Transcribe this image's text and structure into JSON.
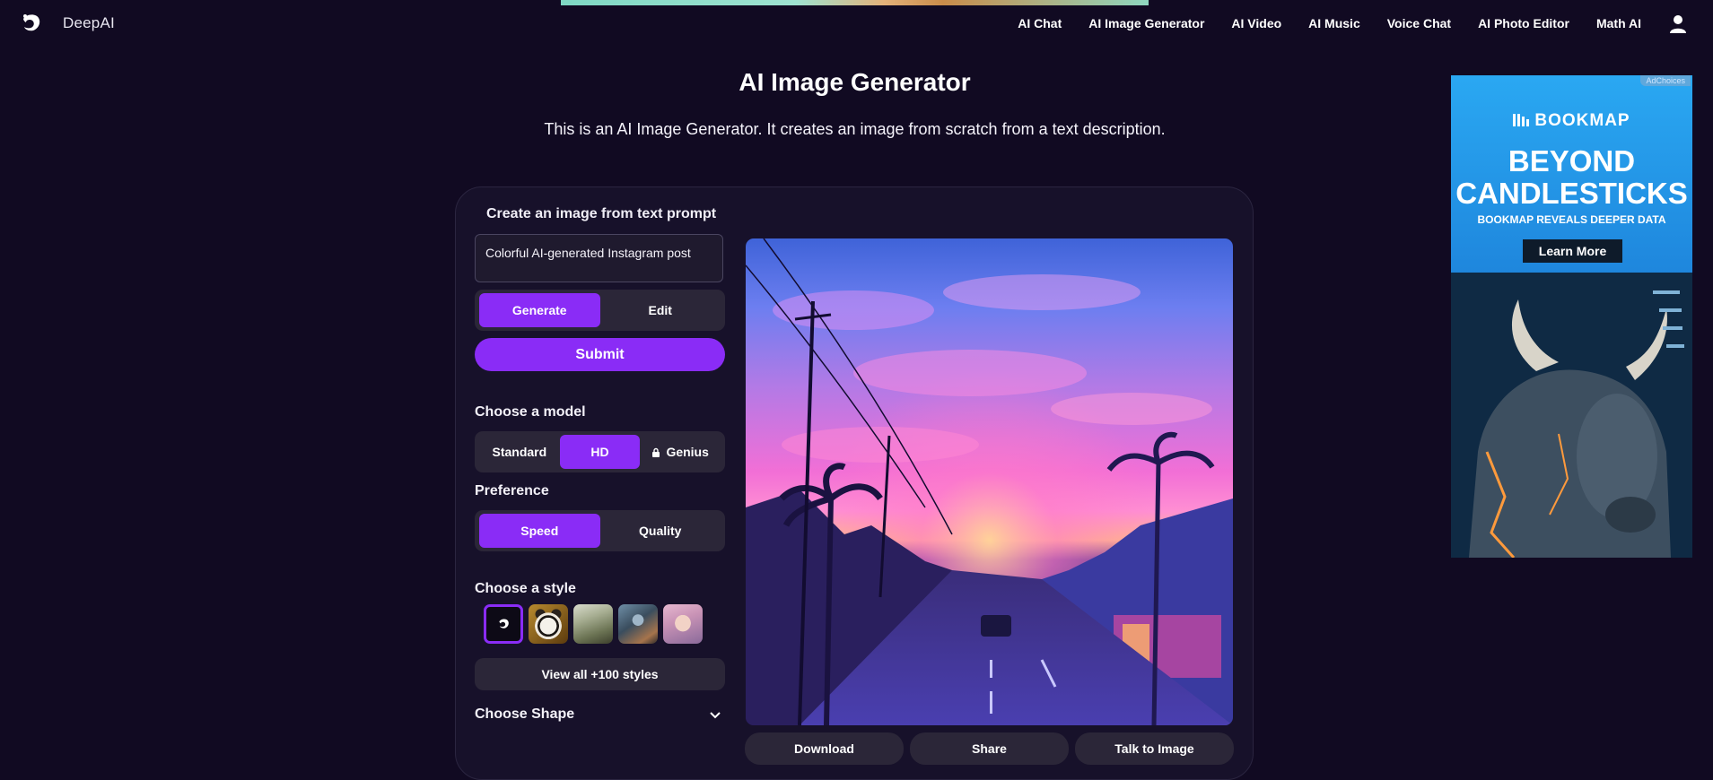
{
  "header": {
    "brand": "DeepAI",
    "nav": [
      "AI Chat",
      "AI Image Generator",
      "AI Video",
      "AI Music",
      "Voice Chat",
      "AI Photo Editor",
      "Math AI"
    ]
  },
  "page": {
    "title": "AI Image Generator",
    "subtitle": "This is an AI Image Generator. It creates an image from scratch from a text description."
  },
  "generator": {
    "card_title": "Create an image from text prompt",
    "prompt_value": "Colorful AI-generated Instagram post",
    "mode": {
      "generate": "Generate",
      "edit": "Edit",
      "selected": "Generate"
    },
    "submit": "Submit",
    "model": {
      "label": "Choose a model",
      "standard": "Standard",
      "hd": "HD",
      "genius": "Genius",
      "selected": "HD"
    },
    "preference": {
      "label": "Preference",
      "speed": "Speed",
      "quality": "Quality",
      "selected": "Speed"
    },
    "style": {
      "label": "Choose a style",
      "view_all": "View all +100 styles"
    },
    "shape": {
      "label": "Choose Shape"
    }
  },
  "output": {
    "download": "Download",
    "share": "Share",
    "talk": "Talk to Image"
  },
  "ad": {
    "adchoices": "AdChoices",
    "brand": "BOOKMAP",
    "headline_1": "BEYOND",
    "headline_2": "CANDLESTICKS",
    "tagline": "BOOKMAP REVEALS DEEPER DATA",
    "cta": "Learn More"
  },
  "colors": {
    "background": "#110a22",
    "accent": "#8a2cf6",
    "panel": "#2b2638"
  }
}
